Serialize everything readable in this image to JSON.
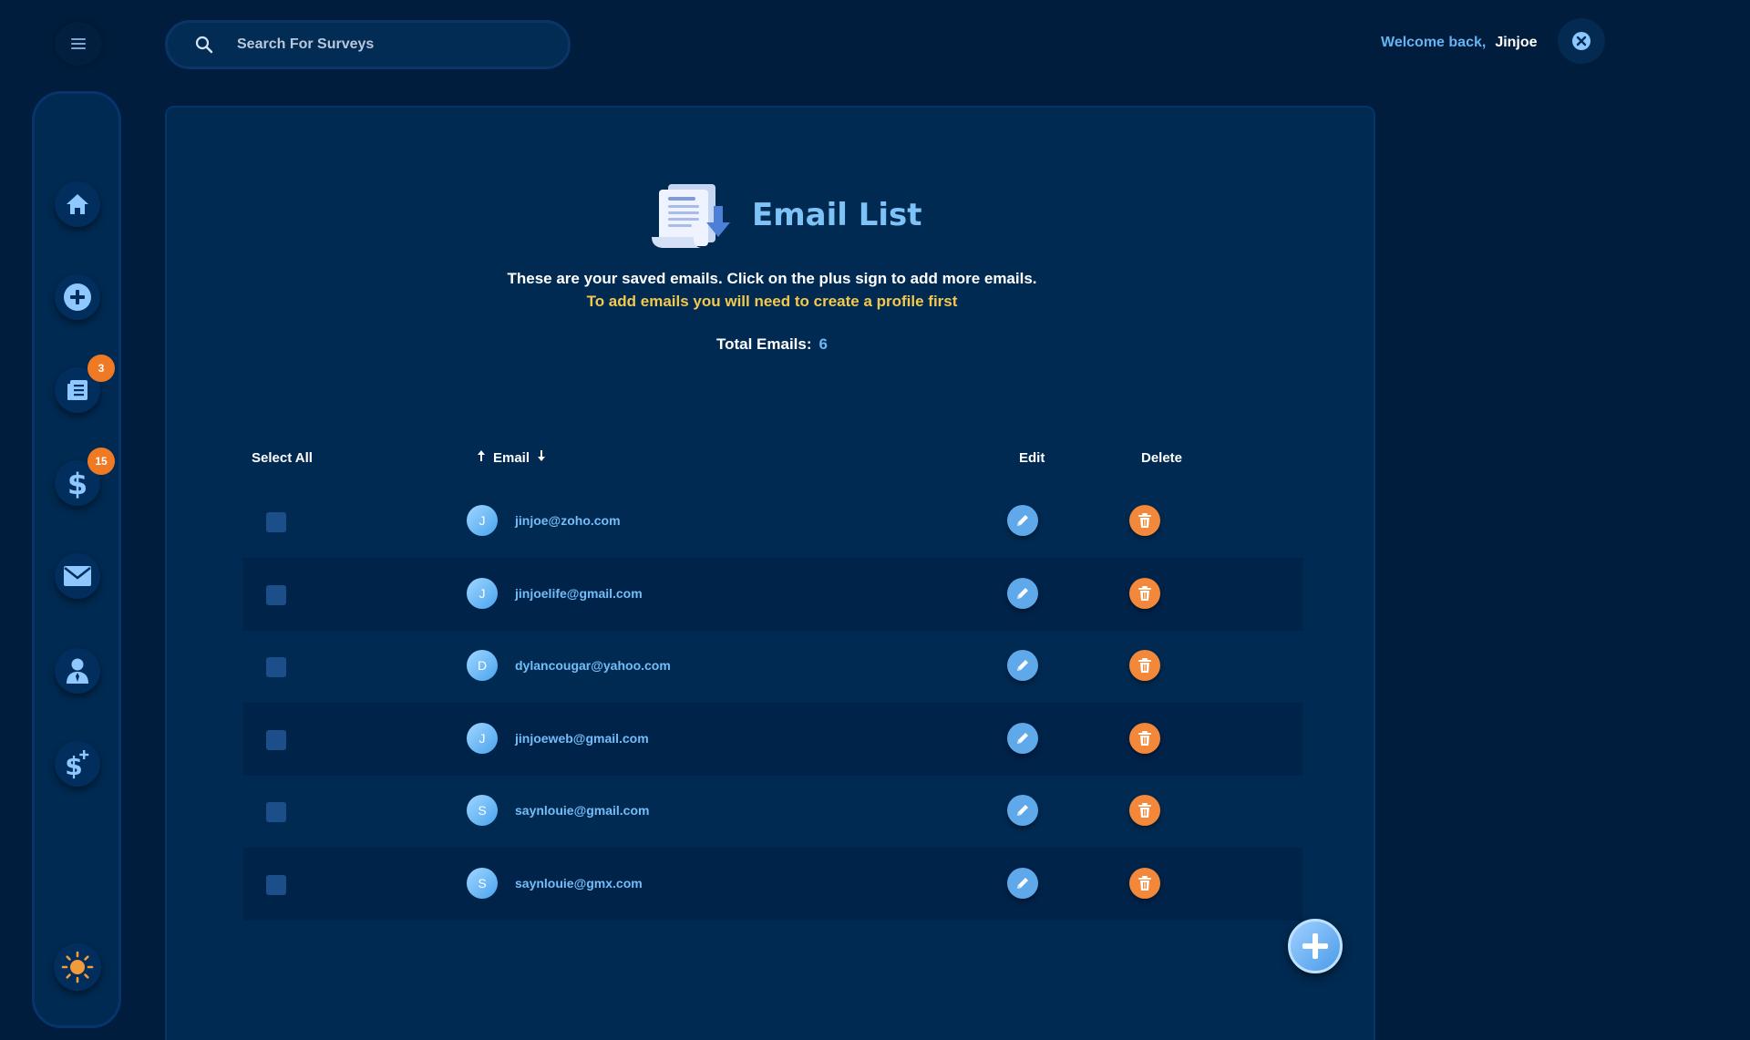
{
  "header": {
    "search_placeholder": "Search For Surveys",
    "welcome_text": "Welcome back,",
    "user_name": "Jinjoe"
  },
  "sidebar": {
    "items": [
      {
        "icon": "home-icon"
      },
      {
        "icon": "add-circle-icon"
      },
      {
        "icon": "surveys-list-icon",
        "badge": "3"
      },
      {
        "icon": "dollar-icon",
        "badge": "15"
      },
      {
        "icon": "mail-icon"
      },
      {
        "icon": "profile-icon"
      },
      {
        "icon": "dollar-plus-icon"
      }
    ],
    "theme_icon": "sun-icon"
  },
  "main": {
    "title": "Email List",
    "description": "These are your saved emails. Click on the plus sign to add more emails.",
    "notice": "To add emails you will need to create a profile first",
    "total_label": "Total Emails:",
    "total_value": "6",
    "columns": {
      "select_all": "Select All",
      "email": "Email",
      "edit": "Edit",
      "delete": "Delete"
    },
    "emails": [
      {
        "initial": "J",
        "address": "jinjoe@zoho.com"
      },
      {
        "initial": "J",
        "address": "jinjoelife@gmail.com"
      },
      {
        "initial": "D",
        "address": "dylancougar@yahoo.com"
      },
      {
        "initial": "J",
        "address": "jinjoeweb@gmail.com"
      },
      {
        "initial": "S",
        "address": "saynlouie@gmail.com"
      },
      {
        "initial": "S",
        "address": "saynlouie@gmx.com"
      }
    ]
  },
  "colors": {
    "background": "#001d3d",
    "panel": "#002a52",
    "accent_blue": "#6fb6f5",
    "accent_orange": "#f07a24",
    "notice_yellow": "#f2c94c"
  }
}
